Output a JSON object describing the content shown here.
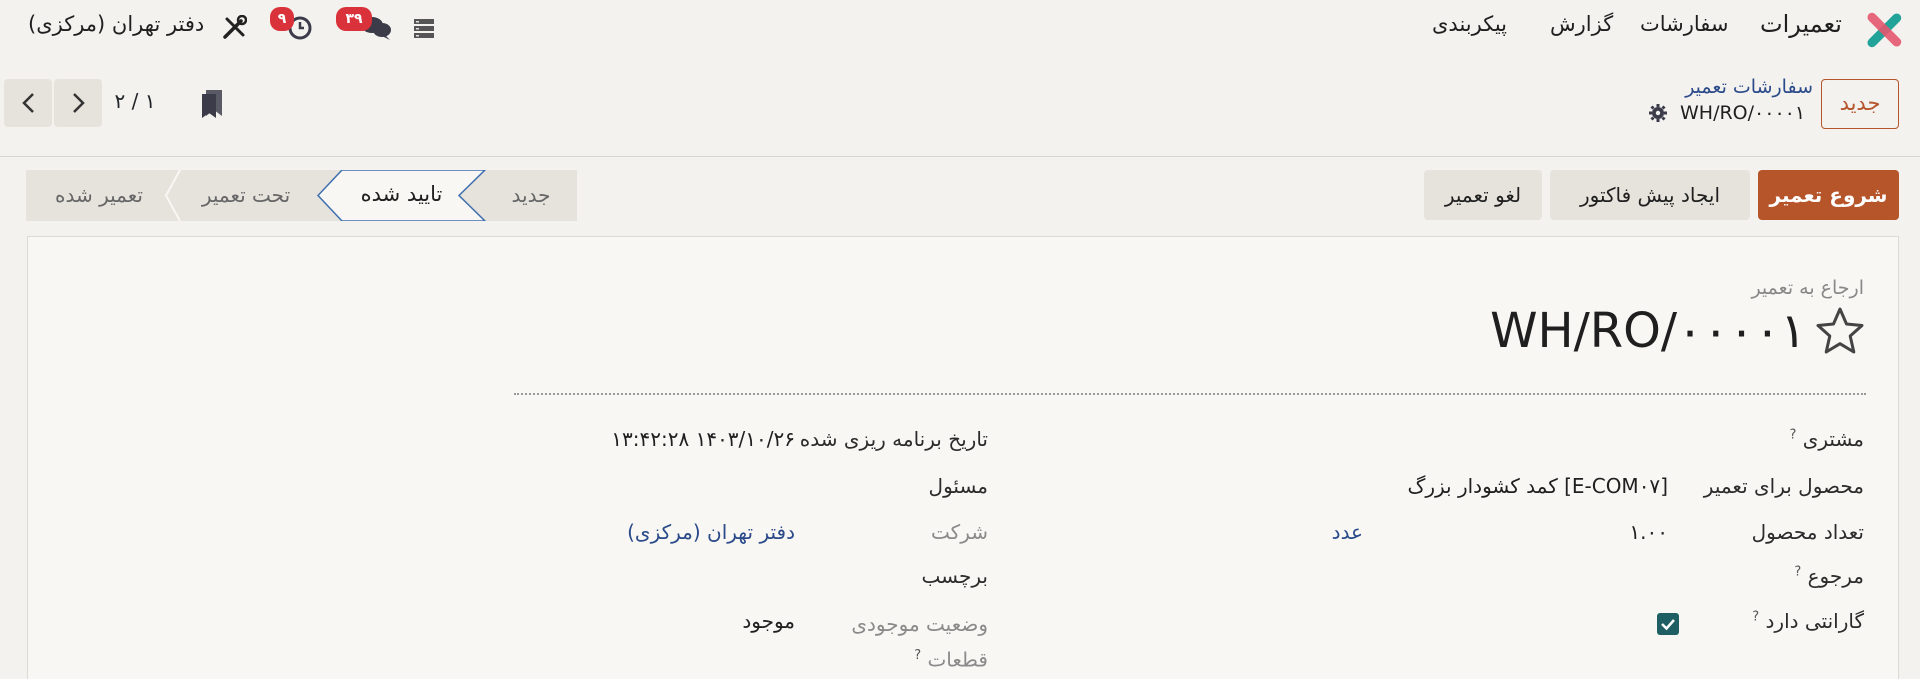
{
  "navbar": {
    "app_name": "تعمیرات",
    "menu": [
      "سفارشات",
      "گزارش",
      "پیکربندی"
    ],
    "company": "دفتر تهران (مرکزی)",
    "messages_count": "۳۹",
    "activities_count": "۹",
    "colors": {
      "logo_teal": "#21a39a",
      "logo_red": "#e4566e",
      "badge": "#d9323a"
    }
  },
  "control_panel": {
    "new_button": "جدید",
    "breadcrumb_parent": "سفارشات تعمیر",
    "record_name": "WH/RO/۰۰۰۰۱",
    "pager": "۱ / ۲"
  },
  "actions": {
    "start_repair": "شروع تعمیر",
    "create_quotation": "ایجاد پیش فاکتور",
    "cancel_repair": "لغو تعمیر"
  },
  "statusbar": {
    "stages": [
      "جدید",
      "تایید شده",
      "تحت تعمیر",
      "تعمیر شده"
    ],
    "active": "تایید شده"
  },
  "form": {
    "subtitle": "ارجاع به تعمیر",
    "title": "WH/RO/۰۰۰۰۱",
    "fields_right": {
      "customer_label": "مشتری",
      "product_label": "محصول برای تعمیر",
      "product_value": "[E-COM۰۷] کمد کشودار بزرگ",
      "qty_label": "تعداد محصول",
      "qty_value": "۱.۰۰",
      "qty_uom": "عدد",
      "return_label": "مرجوع",
      "warranty_label": "گارانتی دارد",
      "warranty_checked": true
    },
    "fields_left": {
      "scheduled_label": "تاریخ برنامه ریزی شده",
      "scheduled_value": "۱۴۰۳/۱۰/۲۶ ۱۳:۴۲:۲۸",
      "responsible_label": "مسئول",
      "company_label": "شرکت",
      "company_value": "دفتر تهران (مرکزی)",
      "tag_label": "برچسب",
      "parts_status_label": "وضعیت موجودی قطعات",
      "parts_status_value": "موجود"
    },
    "help_mark": "?"
  }
}
